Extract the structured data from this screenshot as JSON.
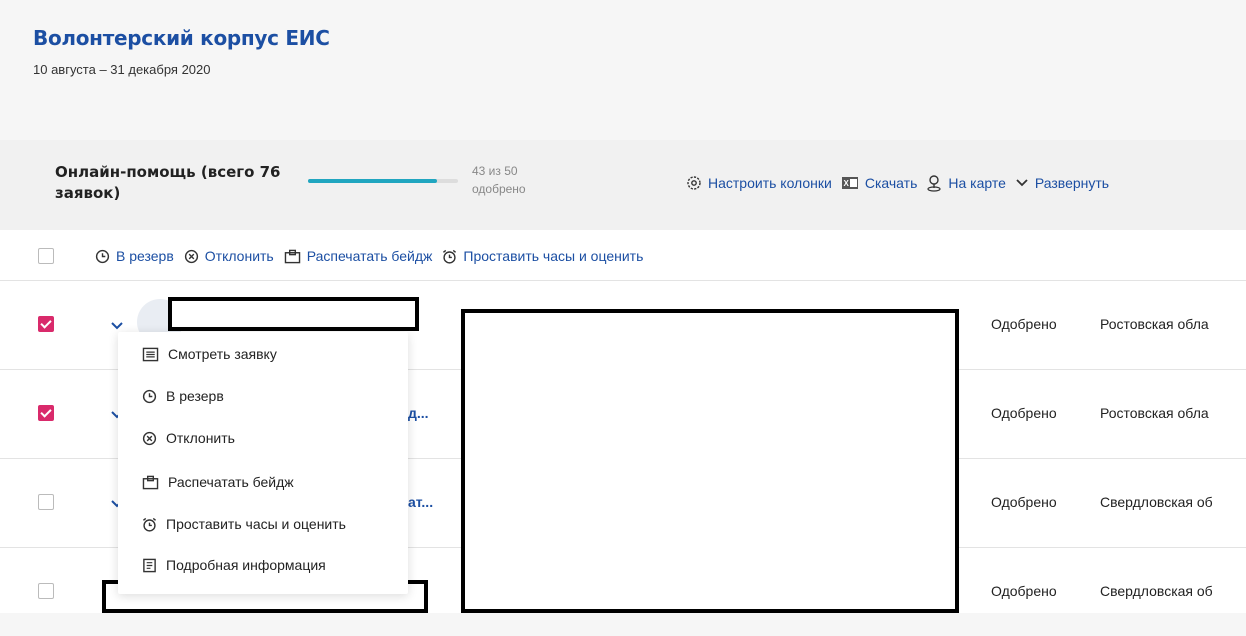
{
  "page": {
    "title": "Волонтерский корпус ЕИС",
    "dates": "10 августа – 31 декабря 2020"
  },
  "group": {
    "title": "Онлайн-помощь (всего 76 заявок)",
    "progress_fraction": 0.86,
    "progress_line1": "43 из 50",
    "progress_line2": "одобрено"
  },
  "toolbar": {
    "configure_columns": "Настроить колонки",
    "download": "Скачать",
    "on_map": "На карте",
    "expand": "Развернуть"
  },
  "bulk_actions": {
    "reserve": "В резерв",
    "reject": "Отклонить",
    "print_badge": "Распечатать бейдж",
    "set_hours": "Проставить часы и оценить"
  },
  "rows": [
    {
      "checked": true,
      "name_fragment": "",
      "status": "Одобрено",
      "region": "Ростовская обла"
    },
    {
      "checked": true,
      "name_fragment": "д...",
      "status": "Одобрено",
      "region": "Ростовская обла"
    },
    {
      "checked": false,
      "name_fragment": "ат...",
      "status": "Одобрено",
      "region": "Свердловская об"
    },
    {
      "checked": false,
      "name_fragment": ".",
      "status": "Одобрено",
      "region": "Свердловская об"
    }
  ],
  "context_menu": {
    "view_application": "Смотреть заявку",
    "reserve": "В резерв",
    "reject": "Отклонить",
    "print_badge": "Распечатать бейдж",
    "set_hours": "Проставить часы и оценить",
    "details": "Подробная информация"
  },
  "colors": {
    "accent": "#1c4fa3",
    "checkbox_checked": "#d92a6b",
    "progress": "#21a6c0"
  }
}
